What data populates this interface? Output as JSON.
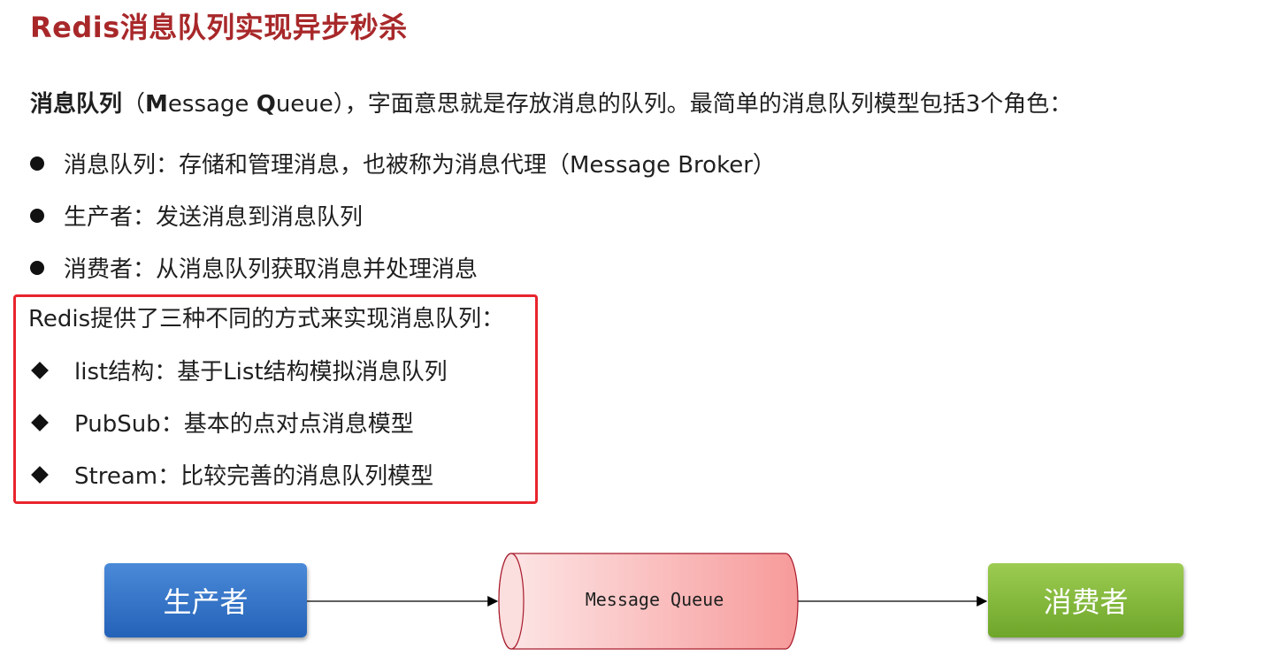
{
  "title": "Redis消息队列实现异步秒杀",
  "intro": {
    "term": "消息队列",
    "open_paren": "（",
    "m_letter": "M",
    "essage": "essage ",
    "q_letter": "Q",
    "ueue": "ueue",
    "rest": "），字面意思就是存放消息的队列。最简单的消息队列模型包括3个角色："
  },
  "roles": [
    {
      "text": "消息队列：存储和管理消息，也被称为消息代理（Message Broker）"
    },
    {
      "text": "生产者：发送消息到消息队列"
    },
    {
      "text": "消费者：从消息队列获取消息并处理消息"
    }
  ],
  "redis_intro": "Redis提供了三种不同的方式来实现消息队列：",
  "redis_methods": [
    {
      "text": "list结构：基于List结构模拟消息队列"
    },
    {
      "text": "PubSub：基本的点对点消息模型"
    },
    {
      "text": "Stream：比较完善的消息队列模型"
    }
  ],
  "diagram": {
    "producer": "生产者",
    "queue": "Message Queue",
    "consumer": "消费者",
    "producer_color": "#3372c4",
    "consumer_color": "#86b93c",
    "queue_color": "#f7a0a0"
  },
  "highlight_color": "#e8242d",
  "title_color": "#a8282a"
}
